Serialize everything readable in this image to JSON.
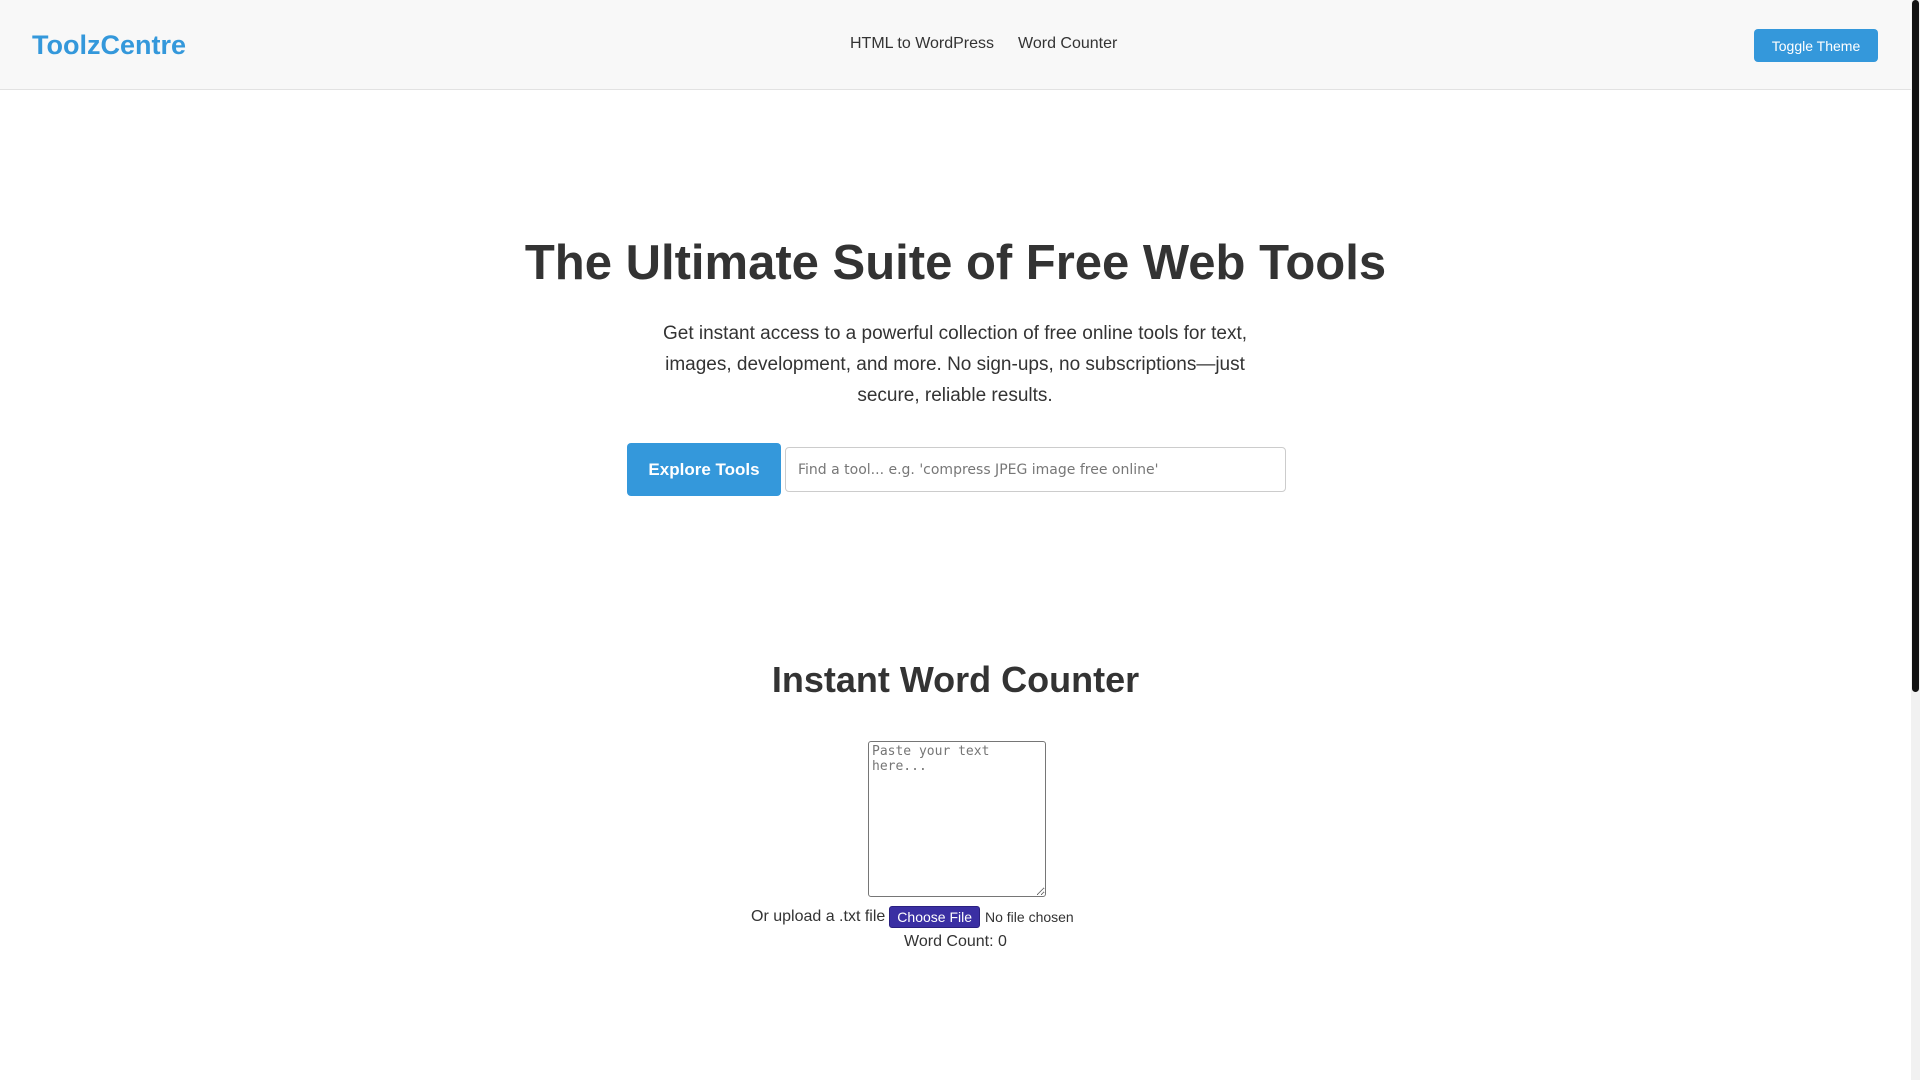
{
  "header": {
    "brand": "ToolzCentre",
    "nav": [
      {
        "label": "HTML to WordPress"
      },
      {
        "label": "Word Counter"
      }
    ],
    "toggle_theme_label": "Toggle Theme"
  },
  "hero": {
    "title": "The Ultimate Suite of Free Web Tools",
    "description": "Get instant access to a powerful collection of free online tools for text, images, development, and more. No sign-ups, no subscriptions—just secure, reliable results.",
    "explore_label": "Explore Tools",
    "search_placeholder": "Find a tool... e.g. 'compress JPEG image free online'"
  },
  "word_counter": {
    "title": "Instant Word Counter",
    "textarea_placeholder": "Paste your text here...",
    "upload_label": "Or upload a .txt file",
    "choose_file_label": "Choose File",
    "no_file_text": "No file chosen",
    "count_label": "Word Count:",
    "count_value": "0"
  },
  "colors": {
    "accent": "#3498db",
    "text": "#333333",
    "header_bg": "#f8f8f8",
    "choose_file_bg": "#3a2fa3"
  }
}
